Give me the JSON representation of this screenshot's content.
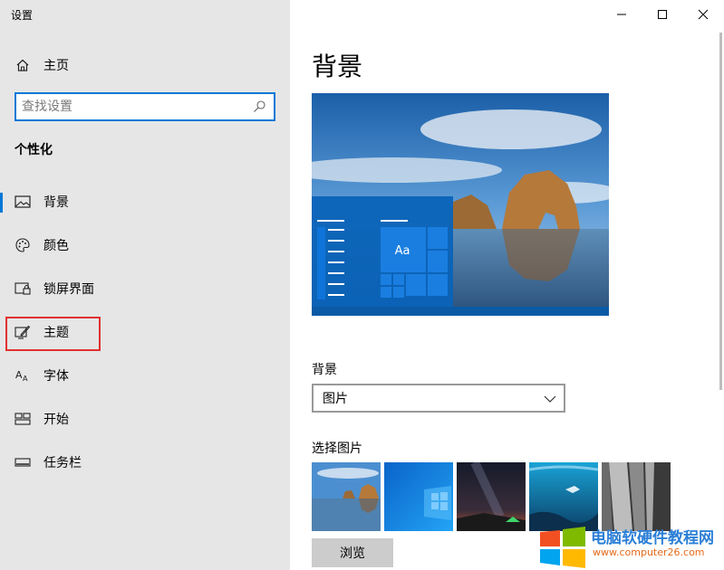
{
  "window": {
    "title": "设置"
  },
  "sidebar": {
    "home_label": "主页",
    "search_placeholder": "查找设置",
    "section_heading": "个性化",
    "items": [
      {
        "label": "背景",
        "icon": "picture-icon",
        "selected": true
      },
      {
        "label": "颜色",
        "icon": "palette-icon"
      },
      {
        "label": "锁屏界面",
        "icon": "lock-screen-icon"
      },
      {
        "label": "主题",
        "icon": "theme-brush-icon"
      },
      {
        "label": "字体",
        "icon": "font-icon"
      },
      {
        "label": "开始",
        "icon": "start-tiles-icon"
      },
      {
        "label": "任务栏",
        "icon": "taskbar-icon"
      }
    ]
  },
  "main": {
    "title": "背景",
    "preview": {
      "sample_text": "Aa"
    },
    "background_label": "背景",
    "background_select_value": "图片",
    "choose_label": "选择图片",
    "thumbnails": [
      "beach-arch",
      "windows-blue",
      "night-sky-tent",
      "underwater-diver",
      "rock-cliff"
    ],
    "browse_label": "浏览"
  },
  "watermark": {
    "title": "电脑软硬件教程网",
    "url": "www.computer26.com"
  },
  "colors": {
    "accent": "#0078d7",
    "sidebar_bg": "#e6e6e6",
    "highlight": "#e0312f"
  }
}
